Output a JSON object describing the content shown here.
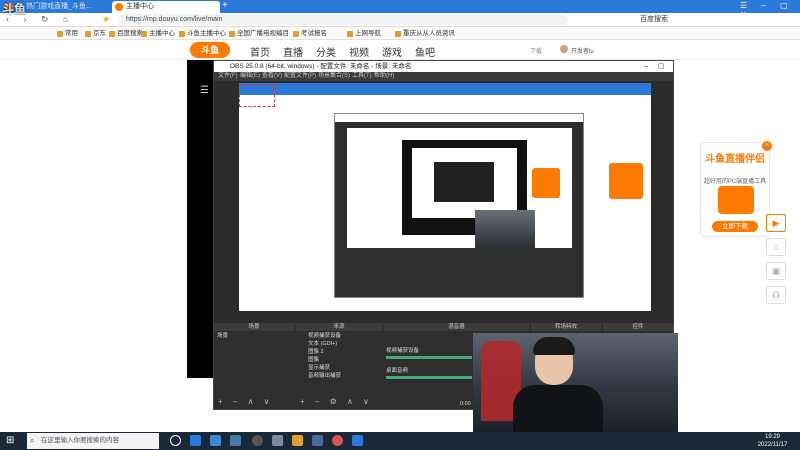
{
  "browser": {
    "tabs": [
      {
        "label": "1 · 热门游戏直播_斗鱼..."
      },
      {
        "label": "主播中心"
      }
    ],
    "new_tab": "+",
    "url": "https://mp.douyu.com/live/main",
    "search_label": "百度搜索",
    "bookmarks": [
      "常用",
      "京东",
      "百度搜索",
      "主播中心",
      "斗鱼主播中心",
      "全国广播电视编目",
      "考试报名",
      "上网导航",
      "重庆从从人员资讯"
    ]
  },
  "douyu_nav": {
    "logo": "斗鱼",
    "items": [
      "首页",
      "直播",
      "分类",
      "视频",
      "游戏",
      "鱼吧"
    ],
    "right": [
      "下载",
      "开发者lu"
    ]
  },
  "obs": {
    "title": "OBS 25.0.8 (64-bit, windows) - 配置文件: 未命名 - 场景: 未命名",
    "menu": [
      "文件(F)",
      "编辑(E)",
      "查看(V)",
      "配置文件(P)",
      "场景集合(S)",
      "工具(T)",
      "帮助(H)"
    ],
    "dock_headers": [
      "场景",
      "来源",
      "混音器",
      "转场特效",
      "控件"
    ],
    "scene": "场景",
    "sources": [
      "视频捕获设备",
      "文本 (GDI+)",
      "图像 2",
      "图像",
      "显示捕获",
      "音频输出捕获"
    ],
    "mixer": [
      "视频捕获设备",
      "桌面音频"
    ],
    "status": "0:00"
  },
  "promo": {
    "title": "斗鱼直播伴侣",
    "subtitle": "超好用的PC端直播工具",
    "button": "立即下载"
  },
  "taskbar": {
    "search_placeholder": "在这里输入你要搜索的内容",
    "time": "19:29",
    "date": "2022/11/17"
  },
  "watermark": "斗鱼"
}
